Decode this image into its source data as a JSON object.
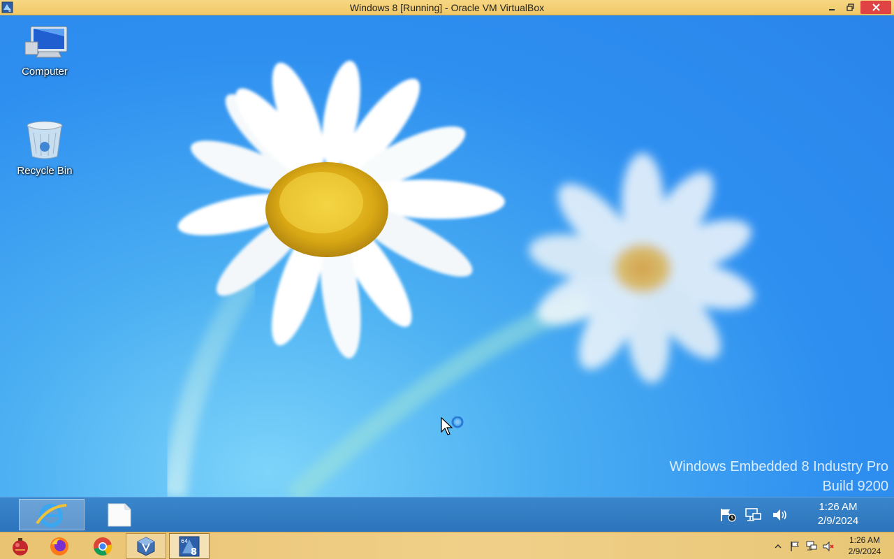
{
  "host_window": {
    "title": "Windows 8 [Running] - Oracle VM VirtualBox",
    "controls": [
      "minimize",
      "restore",
      "close"
    ],
    "accent_color": "#f0c868",
    "close_color": "#e04343"
  },
  "desktop": {
    "icons": [
      {
        "label": "Computer",
        "icon": "computer-icon"
      },
      {
        "label": "Recycle Bin",
        "icon": "recycle-bin-icon"
      }
    ],
    "watermark": {
      "line1": "Windows Embedded 8 Industry Pro",
      "line2": "Build 9200"
    },
    "wallpaper": "daisy-flowers",
    "background_color": "#2e8ff0"
  },
  "guest_taskbar": {
    "pinned": [
      "internet-explorer-icon",
      "blank-file-icon"
    ],
    "tray": [
      "action-center-flag-icon",
      "network-icon",
      "volume-icon"
    ],
    "time": "1:26 AM",
    "date": "2/9/2024"
  },
  "host_taskbar": {
    "apps": [
      "ornament-app-icon",
      "firefox-icon",
      "chrome-icon",
      "virtualbox-icon",
      "windows8-vm-icon"
    ],
    "tray": [
      "show-hidden-icons-chevron",
      "flag-icon",
      "network-icon",
      "volume-muted-icon"
    ],
    "time": "1:26 AM",
    "date": "2/9/2024"
  }
}
